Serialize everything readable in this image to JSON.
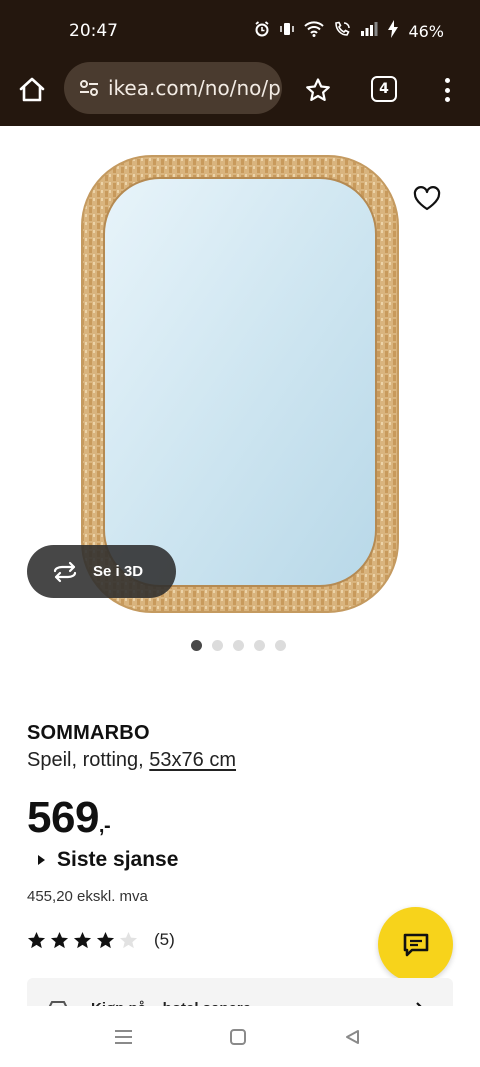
{
  "status_bar": {
    "time": "20:47",
    "battery": "46%"
  },
  "browser": {
    "url": "ikea.com/no/no/p",
    "tab_count": "4"
  },
  "product": {
    "view_3d_label": "Se i 3D",
    "image_count": 5,
    "active_image_index": 0,
    "name": "SOMMARBO",
    "description": "Speil, rotting,",
    "size": "53x76 cm",
    "price": "569",
    "price_suffix": ",-",
    "last_chance_label": "Siste sjanse",
    "price_excl_vat": "455,20 ekskl. mva",
    "rating": 4,
    "rating_max": 5,
    "review_count": "(5)"
  },
  "store_card": {
    "label": "Kjøp på...  hotel sanere"
  },
  "colors": {
    "browser_chrome": "#24170e",
    "urlbar": "#4a3b2f",
    "chat_button": "#f7d31b",
    "rattan": "#d6b07a"
  }
}
